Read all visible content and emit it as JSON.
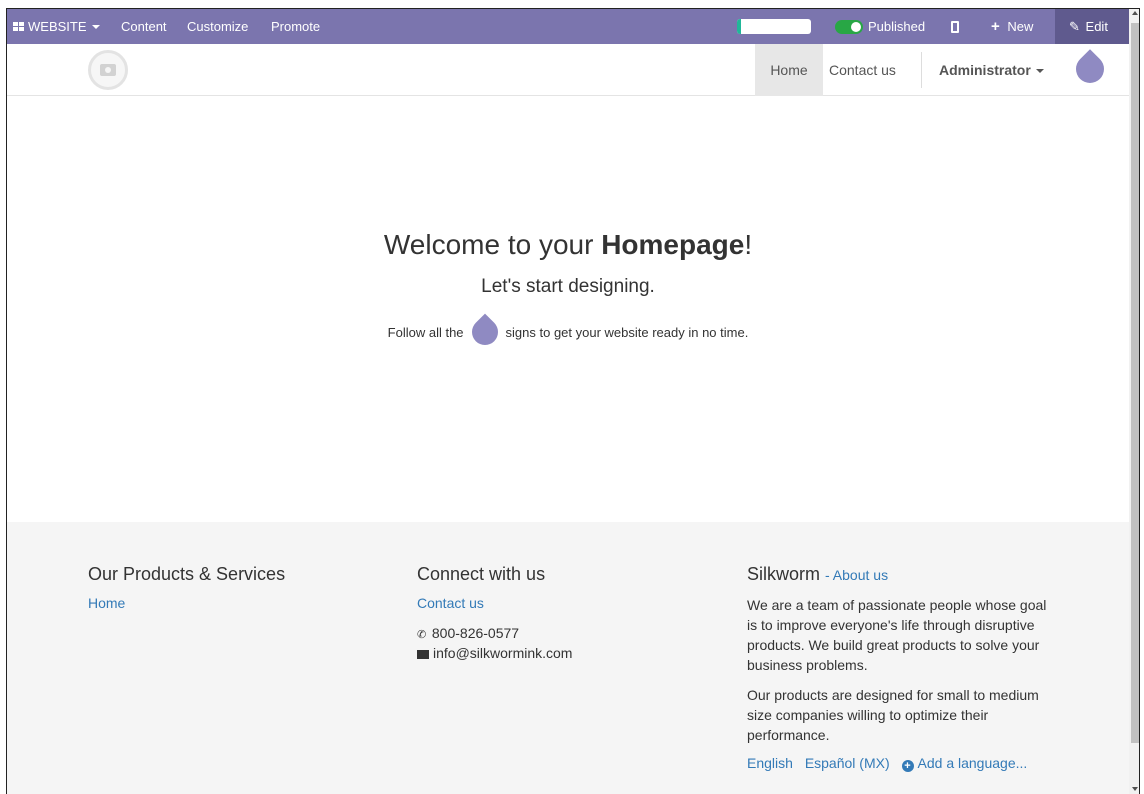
{
  "adminbar": {
    "website_label": "WEBSITE",
    "menu": [
      "Content",
      "Customize",
      "Promote"
    ],
    "progress_fraction": 0.05,
    "published_label": "Published",
    "new_label": "New",
    "edit_label": "Edit"
  },
  "navbar": {
    "items": [
      "Home",
      "Contact us"
    ],
    "user_label": "Administrator"
  },
  "hero": {
    "title_pre": "Welcome to your ",
    "title_bold": "Homepage",
    "title_post": "!",
    "subtitle": "Let's start designing.",
    "hint_pre": "Follow all the",
    "hint_post": "signs to get your website ready in no time."
  },
  "footer": {
    "products": {
      "heading": "Our Products & Services",
      "link": "Home"
    },
    "connect": {
      "heading": "Connect with us",
      "link": "Contact us",
      "phone": "800-826-0577",
      "email": "info@silkwormink.com"
    },
    "about": {
      "heading": "Silkworm",
      "link": "- About us",
      "para1": "We are a team of passionate people whose goal is to improve everyone's life through disruptive products. We build great products to solve your business problems.",
      "para2": "Our products are designed for small to medium size companies willing to optimize their performance.",
      "languages": [
        "English",
        "Español (MX)"
      ],
      "add_language": "Add a language..."
    }
  },
  "colors": {
    "adminbar": "#7b75ae",
    "accent_drop": "#8f8ac2",
    "link": "#337ab7",
    "published_toggle": "#28a745",
    "footer_bg": "#f5f5f5"
  },
  "icons": [
    "apps-grid-icon",
    "caret-down-icon",
    "toggle-icon",
    "mobile-icon",
    "plus-icon",
    "pencil-icon",
    "logo-camera-icon",
    "droplet-icon",
    "phone-icon",
    "envelope-icon",
    "plus-circle-icon"
  ]
}
